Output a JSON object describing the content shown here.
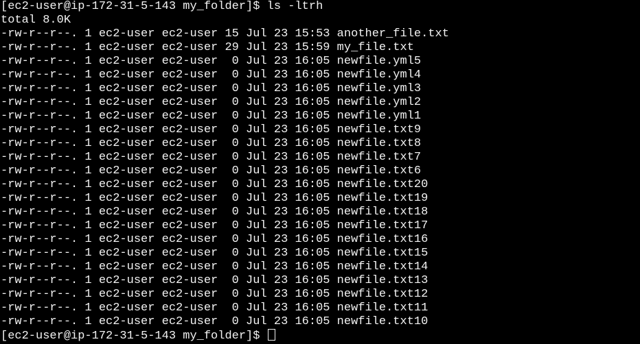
{
  "terminal": {
    "foreground": "#f2f2f2",
    "background": "#000000",
    "prompt": "[ec2-user@ip-172-31-5-143 my_folder]$ ",
    "command": "ls -ltrh",
    "total": "total 8.0K",
    "lines": [
      "-rw-r--r--. 1 ec2-user ec2-user 15 Jul 23 15:53 another_file.txt",
      "-rw-r--r--. 1 ec2-user ec2-user 29 Jul 23 15:59 my_file.txt",
      "-rw-r--r--. 1 ec2-user ec2-user  0 Jul 23 16:05 newfile.yml5",
      "-rw-r--r--. 1 ec2-user ec2-user  0 Jul 23 16:05 newfile.yml4",
      "-rw-r--r--. 1 ec2-user ec2-user  0 Jul 23 16:05 newfile.yml3",
      "-rw-r--r--. 1 ec2-user ec2-user  0 Jul 23 16:05 newfile.yml2",
      "-rw-r--r--. 1 ec2-user ec2-user  0 Jul 23 16:05 newfile.yml1",
      "-rw-r--r--. 1 ec2-user ec2-user  0 Jul 23 16:05 newfile.txt9",
      "-rw-r--r--. 1 ec2-user ec2-user  0 Jul 23 16:05 newfile.txt8",
      "-rw-r--r--. 1 ec2-user ec2-user  0 Jul 23 16:05 newfile.txt7",
      "-rw-r--r--. 1 ec2-user ec2-user  0 Jul 23 16:05 newfile.txt6",
      "-rw-r--r--. 1 ec2-user ec2-user  0 Jul 23 16:05 newfile.txt20",
      "-rw-r--r--. 1 ec2-user ec2-user  0 Jul 23 16:05 newfile.txt19",
      "-rw-r--r--. 1 ec2-user ec2-user  0 Jul 23 16:05 newfile.txt18",
      "-rw-r--r--. 1 ec2-user ec2-user  0 Jul 23 16:05 newfile.txt17",
      "-rw-r--r--. 1 ec2-user ec2-user  0 Jul 23 16:05 newfile.txt16",
      "-rw-r--r--. 1 ec2-user ec2-user  0 Jul 23 16:05 newfile.txt15",
      "-rw-r--r--. 1 ec2-user ec2-user  0 Jul 23 16:05 newfile.txt14",
      "-rw-r--r--. 1 ec2-user ec2-user  0 Jul 23 16:05 newfile.txt13",
      "-rw-r--r--. 1 ec2-user ec2-user  0 Jul 23 16:05 newfile.txt12",
      "-rw-r--r--. 1 ec2-user ec2-user  0 Jul 23 16:05 newfile.txt11",
      "-rw-r--r--. 1 ec2-user ec2-user  0 Jul 23 16:05 newfile.txt10"
    ],
    "final_prompt": "[ec2-user@ip-172-31-5-143 my_folder]$ "
  }
}
